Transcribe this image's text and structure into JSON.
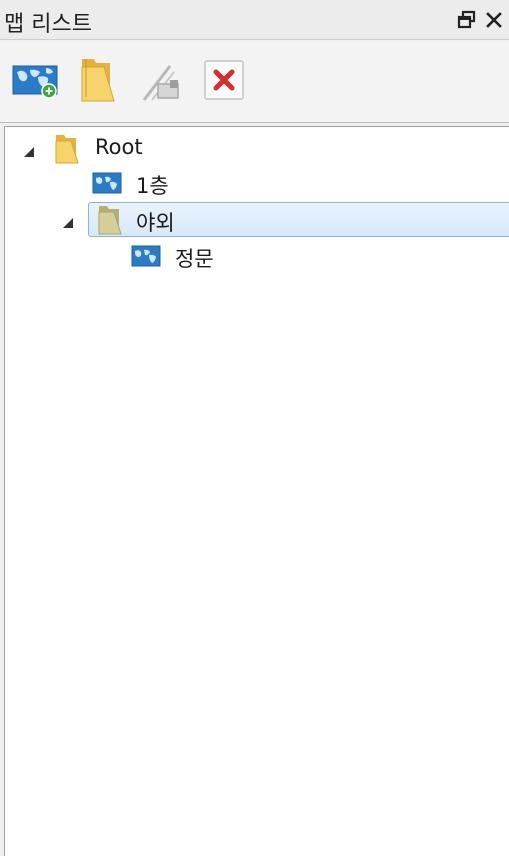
{
  "window": {
    "title": "맵 리스트",
    "float_icon": "float-window-icon",
    "close_icon": "close-icon"
  },
  "toolbar": {
    "buttons": [
      {
        "id": "add-map",
        "icon": "add-map-icon",
        "enabled": true
      },
      {
        "id": "add-folder",
        "icon": "folder-icon",
        "enabled": true
      },
      {
        "id": "rename",
        "icon": "rename-icon",
        "enabled": false
      },
      {
        "id": "delete",
        "icon": "delete-icon",
        "enabled": true
      }
    ]
  },
  "tree": {
    "nodes": [
      {
        "label": "Root",
        "type": "folder",
        "expanded": true,
        "level": 0
      },
      {
        "label": "1층",
        "type": "map",
        "level": 1
      },
      {
        "label": "야외",
        "type": "folder",
        "expanded": true,
        "level": 1,
        "selected": true
      },
      {
        "label": "정문",
        "type": "map",
        "level": 2
      }
    ]
  },
  "colors": {
    "selection_border": "#8ab4dc",
    "selection_fill": "#dbeaf9",
    "map_icon_blue": "#2a7cc9",
    "folder_yellow": "#f2c94c",
    "delete_red": "#d92b2b"
  }
}
